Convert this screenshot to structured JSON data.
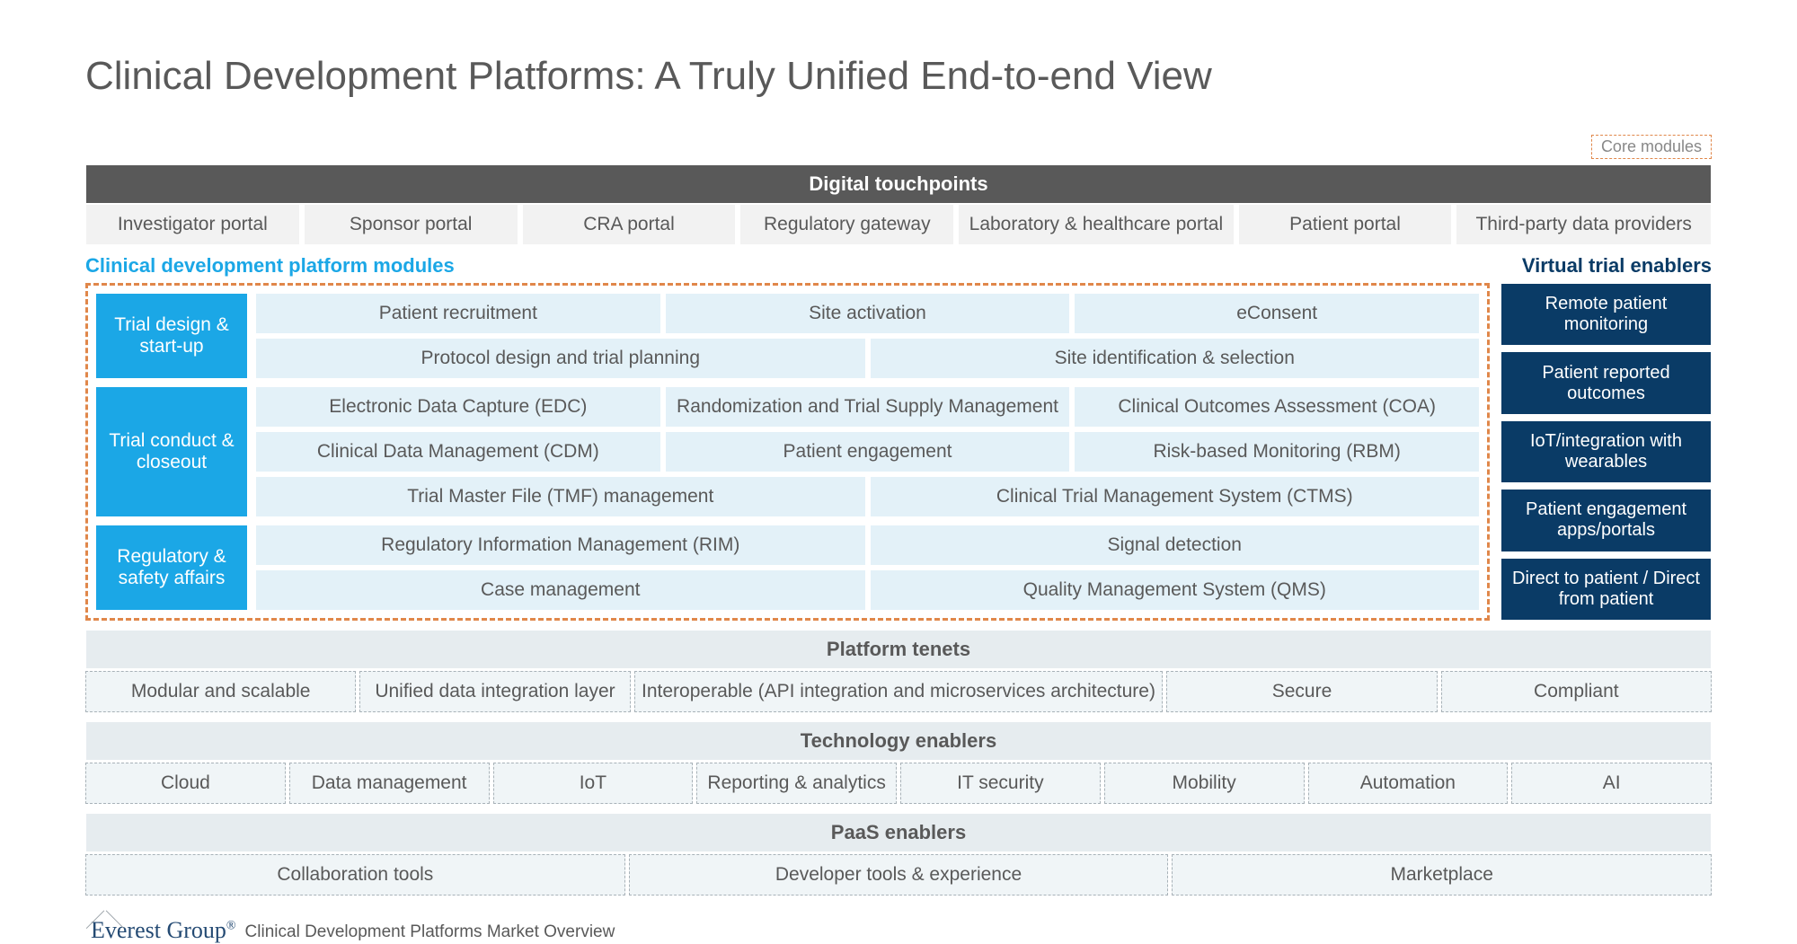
{
  "title": "Clinical Development Platforms: A Truly Unified End-to-end View",
  "core_modules_badge": "Core modules",
  "digital_touchpoints": {
    "header": "Digital touchpoints",
    "items": [
      "Investigator portal",
      "Sponsor portal",
      "CRA portal",
      "Regulatory gateway",
      "Laboratory & healthcare portal",
      "Patient portal",
      "Third-party data providers"
    ]
  },
  "section_labels": {
    "left": "Clinical development platform modules",
    "right": "Virtual trial enablers"
  },
  "phases": {
    "design": {
      "label": "Trial design & start-up",
      "row1": [
        "Patient recruitment",
        "Site activation",
        "eConsent"
      ],
      "row2": [
        "Protocol design and trial planning",
        "Site identification & selection"
      ]
    },
    "conduct": {
      "label": "Trial conduct & closeout",
      "row1": [
        "Electronic Data Capture (EDC)",
        "Randomization and Trial Supply Management",
        "Clinical Outcomes Assessment (COA)"
      ],
      "row2": [
        "Clinical Data Management (CDM)",
        "Patient engagement",
        "Risk-based Monitoring (RBM)"
      ],
      "row3": [
        "Trial Master File (TMF) management",
        "Clinical Trial Management System (CTMS)"
      ]
    },
    "regulatory": {
      "label": "Regulatory & safety affairs",
      "row1": [
        "Regulatory Information Management (RIM)",
        "Signal detection"
      ],
      "row2": [
        "Case management",
        "Quality Management System (QMS)"
      ]
    }
  },
  "virtual_trial_enablers": [
    "Remote patient monitoring",
    "Patient reported outcomes",
    "IoT/integration with wearables",
    "Patient engagement apps/portals",
    "Direct to patient / Direct from patient"
  ],
  "platform_tenets": {
    "header": "Platform tenets",
    "items": [
      "Modular and scalable",
      "Unified data integration layer",
      "Interoperable (API integration and microservices architecture)",
      "Secure",
      "Compliant"
    ]
  },
  "technology_enablers": {
    "header": "Technology enablers",
    "items": [
      "Cloud",
      "Data management",
      "IoT",
      "Reporting & analytics",
      "IT security",
      "Mobility",
      "Automation",
      "AI"
    ]
  },
  "paas_enablers": {
    "header": "PaaS enablers",
    "items": [
      "Collaboration tools",
      "Developer tools & experience",
      "Marketplace"
    ]
  },
  "footer": {
    "logo": "Everest Group",
    "reg": "®",
    "text": "Clinical Development Platforms Market Overview"
  }
}
